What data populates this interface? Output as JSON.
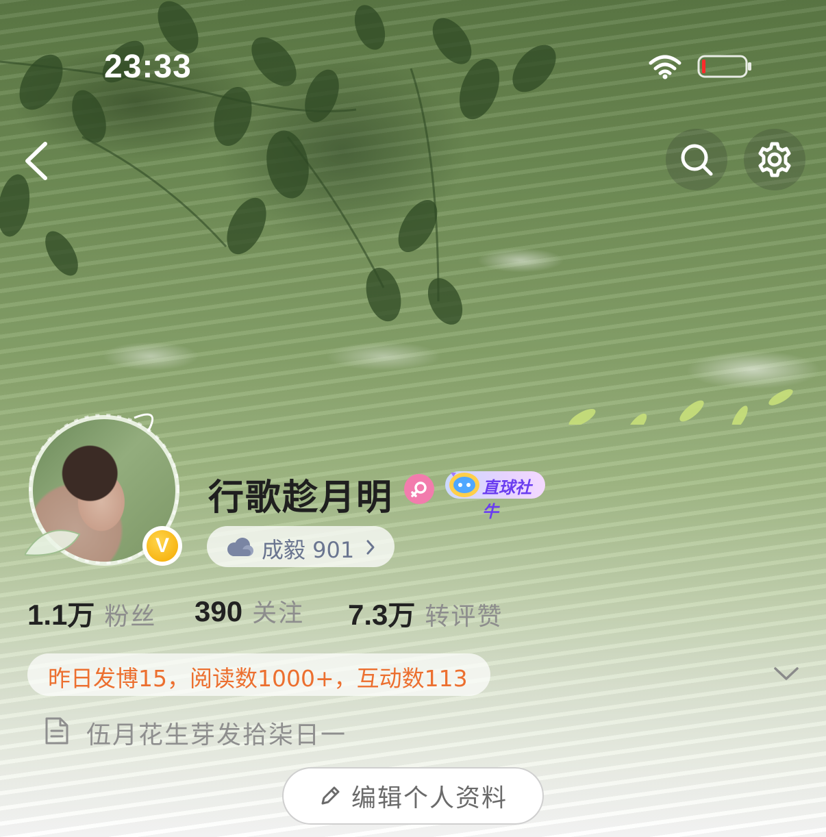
{
  "status_bar": {
    "time": "23:33"
  },
  "profile": {
    "username": "行歌趁月明",
    "medal_label": "直球社牛",
    "level_label": "成毅 901",
    "stats": [
      {
        "value": "1.1",
        "unit": "万",
        "label": "粉丝"
      },
      {
        "value": "390",
        "unit": "",
        "label": "关注"
      },
      {
        "value": "7.3",
        "unit": "万",
        "label": "转评赞"
      }
    ],
    "activity_summary": "昨日发博15，阅读数1000+，互动数113",
    "bio": "伍月花生芽发拾柒日一",
    "edit_button_label": "编辑个人资料",
    "verified_badge_letter": "V"
  },
  "colors": {
    "accent_orange": "#ec6f2f",
    "gender_pink": "#f27cad",
    "verified_gold": "#f4aa00",
    "level_text": "#6a7590"
  },
  "icons": {
    "back": "chevron-left-icon",
    "search": "search-icon",
    "settings": "gear-icon",
    "gender": "female-icon",
    "level": "cloud-icon",
    "expand": "chevron-down-icon",
    "bio": "document-icon",
    "edit": "pencil-icon"
  }
}
